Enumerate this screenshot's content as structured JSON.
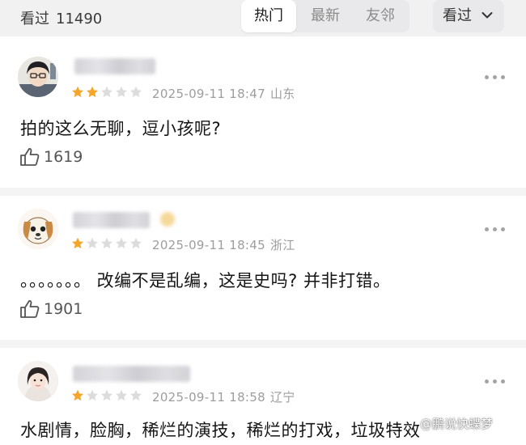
{
  "header": {
    "watch_label": "看过",
    "watch_count": "11490",
    "tabs": [
      {
        "label": "热门",
        "active": true
      },
      {
        "label": "最新",
        "active": false
      },
      {
        "label": "友邻",
        "active": false
      }
    ],
    "filter_label": "看过"
  },
  "comments": [
    {
      "rating": 2,
      "rating_max": 5,
      "time": "2025-09-11 18:47",
      "location": "山东",
      "text": "拍的这么无聊，逗小孩呢?",
      "likes": "1619"
    },
    {
      "rating": 1,
      "rating_max": 5,
      "time": "2025-09-11 18:45",
      "location": "浙江",
      "text": "。。。。。。。 改编不是乱编，这是史吗? 并非打错。",
      "likes": "1901"
    },
    {
      "rating": 1,
      "rating_max": 5,
      "time": "2025-09-11 18:58",
      "location": "辽宁",
      "text": "水剧情，脸胸，稀烂的演技，稀烂的打戏，垃圾特效"
    }
  ],
  "colors": {
    "star_filled": "#f4a52a",
    "star_empty": "#dcdcdc",
    "meta_text": "#9d9d9d",
    "header_bg": "#f1f1f2"
  },
  "icons": {
    "more": "more-dots-icon",
    "like": "thumbs-up-icon",
    "filter_arrow": "chevron-down-icon"
  },
  "watermark": "@鹏说快蝶梦"
}
